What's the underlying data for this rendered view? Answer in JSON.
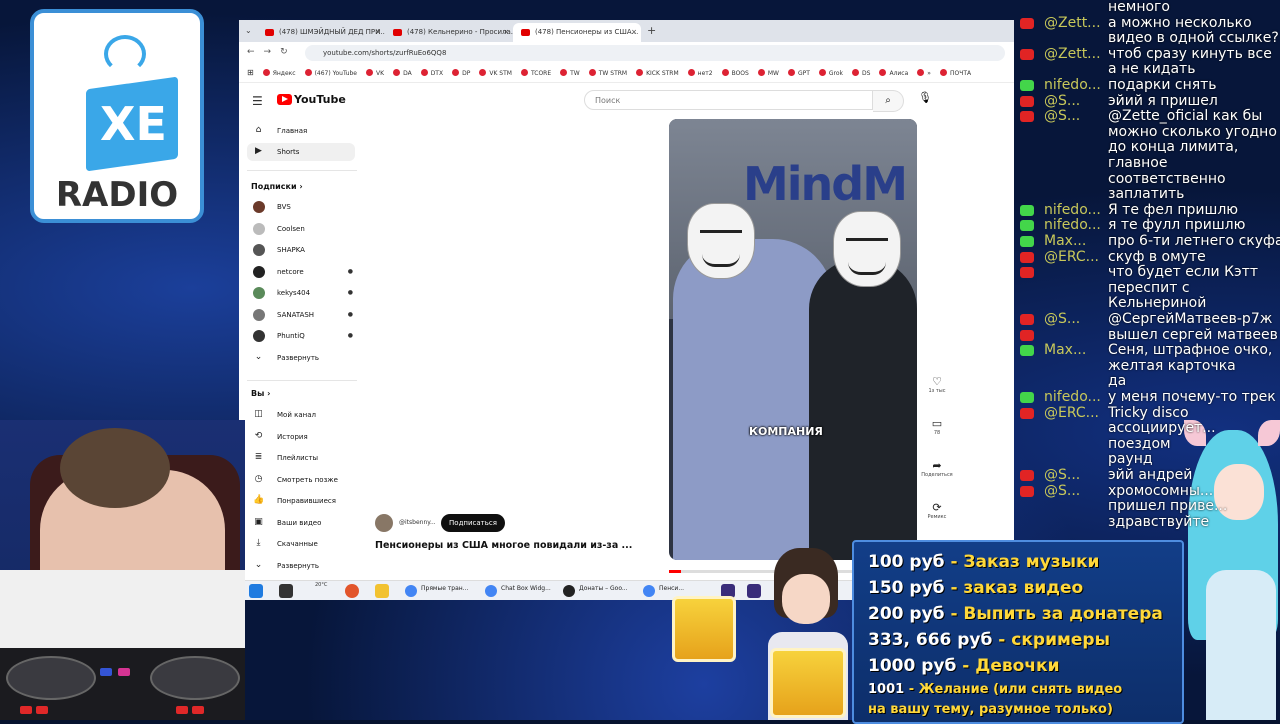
{
  "logo": {
    "letters": "XE",
    "word": "RADIO"
  },
  "browser": {
    "tabs": [
      {
        "label": "(478) ШМЭЙДНЫЙ ДЕД ПРИ..."
      },
      {
        "label": "(478) Кельнерино - Просила..."
      },
      {
        "label": "(478) Пенсионеры из США..."
      }
    ],
    "new_tab": "+",
    "url": "youtube.com/shorts/zurfRuEo6QQ8",
    "bookmarks": [
      "Яндекс",
      "(467) YouTube",
      "VK",
      "DA",
      "DTX",
      "DP",
      "VK STM",
      "TCORE",
      "TW",
      "TW STRM",
      "KICK STRM",
      "нет2",
      "BOOS",
      "MW",
      "GPT",
      "Grok",
      "DS",
      "Алиса",
      "»",
      "ПОЧТА"
    ]
  },
  "youtube": {
    "logo_text": "YouTube",
    "search_placeholder": "Поиск",
    "sidebar": {
      "main": [
        {
          "label": "Главная",
          "icon": "home-icon"
        },
        {
          "label": "Shorts",
          "icon": "shorts-icon"
        }
      ],
      "subscriptions_header": "Подписки",
      "subscriptions": [
        {
          "label": "BVS",
          "color": "#6b3a2a",
          "dot": false
        },
        {
          "label": "Coolsen",
          "color": "#bbbbbb",
          "dot": false
        },
        {
          "label": "SHAPKA",
          "color": "#555555",
          "dot": false
        },
        {
          "label": "netcore",
          "color": "#222222",
          "dot": true
        },
        {
          "label": "kekys404",
          "color": "#5a8a5a",
          "dot": true
        },
        {
          "label": "SANATASH",
          "color": "#777777",
          "dot": true
        },
        {
          "label": "PhuntiQ",
          "color": "#333333",
          "dot": true
        }
      ],
      "expand_label": "Развернуть",
      "you_header": "Вы",
      "you_items": [
        {
          "label": "Мой канал",
          "icon": "channel-icon"
        },
        {
          "label": "История",
          "icon": "history-icon"
        },
        {
          "label": "Плейлисты",
          "icon": "playlist-icon"
        },
        {
          "label": "Смотреть позже",
          "icon": "clock-icon"
        },
        {
          "label": "Понравившиеся",
          "icon": "thumb-up-icon"
        },
        {
          "label": "Ваши видео",
          "icon": "video-icon"
        },
        {
          "label": "Скачанные",
          "icon": "download-icon"
        },
        {
          "label": "Развернуть",
          "icon": "chevron-down-icon"
        }
      ]
    },
    "video": {
      "caption": "КОМПАНИЯ",
      "wall_text": "MindM",
      "channel": "@itsbenny...",
      "subscribe_label": "Подписаться",
      "title": "Пенсионеры из США многое повидали из-за ...",
      "progress": 0.05
    },
    "actions": [
      {
        "icon": "heart-icon",
        "label": "1з тыс"
      },
      {
        "icon": "comment-icon",
        "label": "78"
      },
      {
        "icon": "share-icon",
        "label": "Поделиться"
      },
      {
        "icon": "remix-icon",
        "label": "Ремикс"
      }
    ]
  },
  "taskbar": [
    {
      "label": "Прямые тран...",
      "color": "#4285f4"
    },
    {
      "label": "Chat Box Widg...",
      "color": "#4285f4"
    },
    {
      "label": "Донаты – Goo...",
      "color": "#222222"
    },
    {
      "label": "Пенси...",
      "color": "#4285f4"
    }
  ],
  "taskbar_temp": "20°C",
  "chat": [
    {
      "name": "",
      "msg": "немного",
      "badges": []
    },
    {
      "name": "@Zett...",
      "msg": "а можно несколько",
      "badges": [
        "yt"
      ]
    },
    {
      "name": "",
      "msg": "видео в одной ссылке?",
      "badges": []
    },
    {
      "name": "@Zett...",
      "msg": "чтоб сразу кинуть все",
      "badges": [
        "yt"
      ]
    },
    {
      "name": "",
      "msg": "а не кидать",
      "badges": []
    },
    {
      "name": "nifedo...",
      "msg": "подарки снять",
      "badges": [
        "k"
      ]
    },
    {
      "name": "@S...",
      "msg": "эйий я пришел",
      "badges": [
        "yt"
      ]
    },
    {
      "name": "@S...",
      "msg": "@Zette_oficial как бы",
      "badges": [
        "yt"
      ]
    },
    {
      "name": "",
      "msg": "можно сколько угодно",
      "badges": []
    },
    {
      "name": "",
      "msg": "до конца лимита,",
      "badges": []
    },
    {
      "name": "",
      "msg": "главное",
      "badges": []
    },
    {
      "name": "",
      "msg": "соответственно",
      "badges": []
    },
    {
      "name": "",
      "msg": "заплатить",
      "badges": []
    },
    {
      "name": "nifedo...",
      "msg": "Я те фел пришлю",
      "badges": [
        "k"
      ]
    },
    {
      "name": "nifedo...",
      "msg": "я те фулл пришлю",
      "badges": [
        "k"
      ]
    },
    {
      "name": "Max...",
      "msg": "про 6-ти летнего скуфа",
      "badges": [
        "k"
      ]
    },
    {
      "name": "@ERC...",
      "msg": "скуф в омуте",
      "badges": [
        "yt"
      ]
    },
    {
      "name": "",
      "msg": "что будет если Кэтт",
      "badges": [
        "yt"
      ]
    },
    {
      "name": "",
      "msg": "переспит с",
      "badges": []
    },
    {
      "name": "",
      "msg": "Кельнериной",
      "badges": []
    },
    {
      "name": "@S...",
      "msg": "@СергейМатвеев-р7ж",
      "badges": [
        "yt"
      ]
    },
    {
      "name": "",
      "msg": "вышел сергей матвеев",
      "badges": [
        "yt"
      ]
    },
    {
      "name": "Max...",
      "msg": "Сеня, штрафное очко,",
      "badges": [
        "k"
      ]
    },
    {
      "name": "",
      "msg": "желтая карточка",
      "badges": []
    },
    {
      "name": "",
      "msg": "да",
      "badges": []
    },
    {
      "name": "nifedo...",
      "msg": "у меня почему-то трек",
      "badges": [
        "k"
      ]
    },
    {
      "name": "@ERC...",
      "msg": "Tricky disco",
      "badges": [
        "yt"
      ]
    },
    {
      "name": "",
      "msg": "ассоциирует...",
      "badges": []
    },
    {
      "name": "",
      "msg": "поездом",
      "badges": []
    },
    {
      "name": "",
      "msg": "раунд",
      "badges": []
    },
    {
      "name": "@S...",
      "msg": "эйй андрей",
      "badges": [
        "yt"
      ]
    },
    {
      "name": "@S...",
      "msg": "хромосомны...",
      "badges": [
        "yt"
      ]
    },
    {
      "name": "",
      "msg": "пришел приве...",
      "badges": []
    },
    {
      "name": "",
      "msg": "здравствуйте",
      "badges": []
    }
  ],
  "price_list": [
    {
      "amount": "100 руб",
      "desc": " - Заказ музыки"
    },
    {
      "amount": "150 руб",
      "desc": " - заказ видео"
    },
    {
      "amount": "200 руб",
      "desc": " - Выпить за донатера"
    },
    {
      "amount": "333, 666 руб",
      "desc": " - скримеры"
    },
    {
      "amount": "1000 руб",
      "desc": " - Девочки"
    },
    {
      "amount": "1001",
      "desc": " - Желание (или снять видео"
    },
    {
      "amount": "",
      "desc": "на вашу тему, разумное только)"
    }
  ]
}
